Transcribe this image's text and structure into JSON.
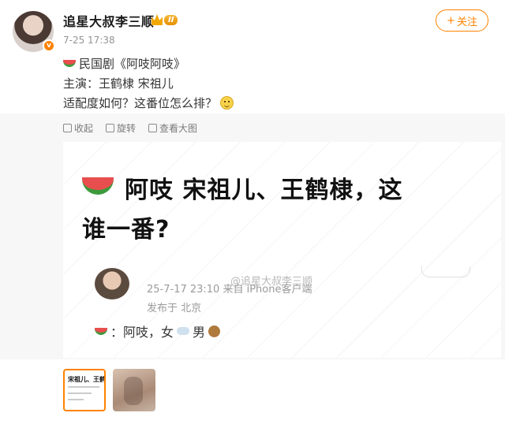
{
  "header": {
    "username": "追星大叔李三顺",
    "vip_level": "II",
    "timestamp": "7-25 17:38",
    "follow_label": "关注",
    "follow_plus": "+"
  },
  "post": {
    "line1": "民国剧《阿吱阿吱》",
    "line2": "主演：王鹤棣  宋祖儿",
    "line3": "适配度如何？这番位怎么排？"
  },
  "toolbar": {
    "collapse": "收起",
    "rotate": "旋转",
    "view_full": "查看大图"
  },
  "image": {
    "title_line1": "阿吱 宋祖儿、王鹤棣，这",
    "title_line2": "谁一番?",
    "watermark": "@追星大叔李三顺",
    "inner_meta": "25-7-17 23:10  来自 iPhone客户端",
    "inner_location": "发布于 北京",
    "inner_comment_a": "：阿吱，女",
    "inner_comment_b": "男"
  },
  "thumbnails": {
    "thumb1_text": "宋祖儿、王鹤棣"
  },
  "colors": {
    "accent": "#ff8200",
    "text": "#333333",
    "muted": "#939393"
  }
}
